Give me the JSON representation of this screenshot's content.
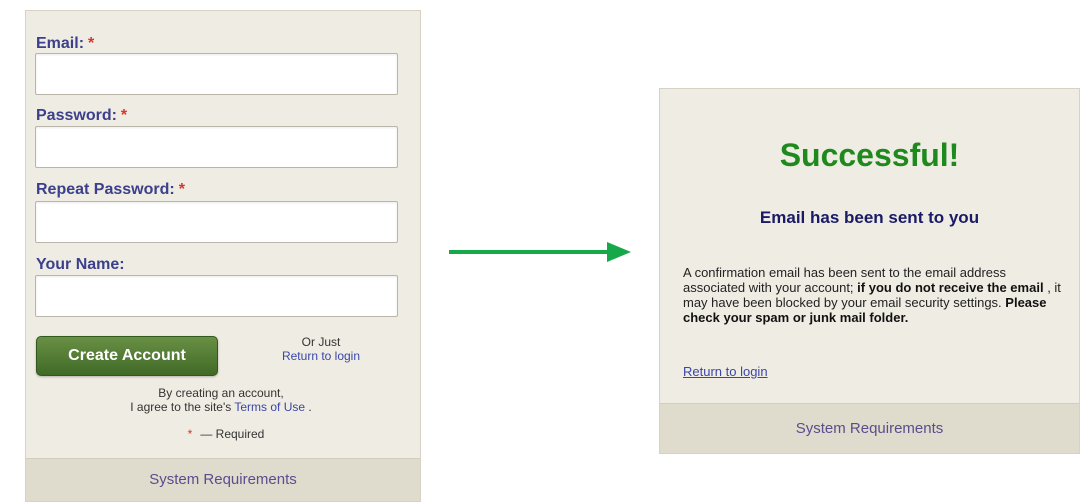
{
  "signup": {
    "email_label": "Email:",
    "password_label": "Password:",
    "repeat_password_label": "Repeat Password:",
    "name_label": "Your Name:",
    "required_star": "*",
    "email_value": "",
    "password_value": "",
    "repeat_password_value": "",
    "name_value": "",
    "create_button": "Create Account",
    "or_just": "Or Just",
    "return_login": "Return to login",
    "agree_line1": "By creating an account,",
    "agree_line2_prefix": "I agree to the site's",
    "terms_link": "Terms of Use",
    "agree_suffix": ".",
    "required_note": "— Required",
    "footer": "System Requirements"
  },
  "confirmation": {
    "title": "Successful!",
    "subtitle": "Email has been sent to you",
    "text_1": "A confirmation email has been sent to the email address associated with your account;",
    "text_bold_1": "if you do not receive the email",
    "text_2": ", it may have been blocked by your email security settings.",
    "text_bold_2": "Please check your spam or junk mail folder.",
    "return_login": "Return to login",
    "footer": "System Requirements"
  },
  "colors": {
    "panel_bg": "#efece3",
    "label_color": "#3b3f8c",
    "required_color": "#d9342b",
    "button_green": "#4f7a33",
    "success_green": "#1e8a1e",
    "arrow_green": "#17a84a",
    "link_color": "#3a46a8"
  },
  "icons": {
    "flow_arrow": "arrow-right-icon"
  }
}
